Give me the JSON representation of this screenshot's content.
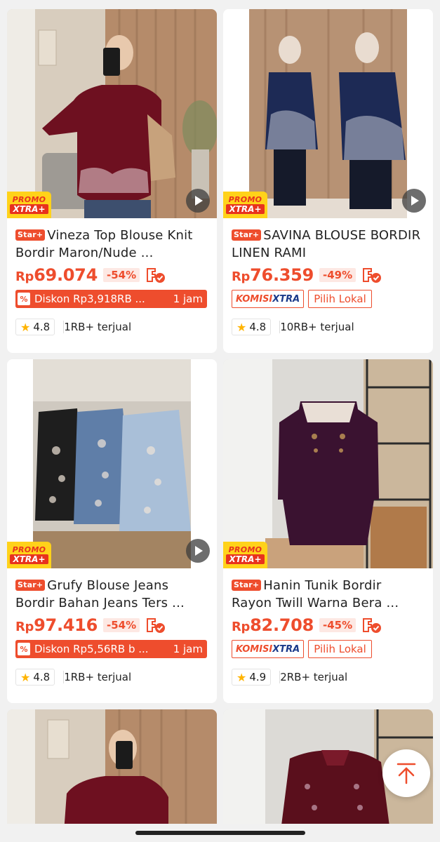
{
  "products": [
    {
      "promo_line1": "PROMO",
      "promo_line2": "XTRA+",
      "star_label": "Star+",
      "title": "Vineza Top Blouse Knit Bordir Maron/Nude ...",
      "price_currency": "Rp",
      "price_amount": "69.074",
      "discount": "-54%",
      "tag_type": "diskon",
      "diskon_text": "Diskon Rp3,918RB ...",
      "diskon_time": "1 jam",
      "rating": "4.8",
      "sold": "1RB+ terjual"
    },
    {
      "promo_line1": "PROMO",
      "promo_line2": "XTRA+",
      "star_label": "Star+",
      "title": "SAVINA BLOUSE BORDIR LINEN RAMI",
      "price_currency": "Rp",
      "price_amount": "76.359",
      "discount": "-49%",
      "tag_type": "komisi",
      "komisi_part1": "KOMISI",
      "komisi_part2": "XTRA",
      "lokal_label": "Pilih Lokal",
      "rating": "4.8",
      "sold": "10RB+ terjual"
    },
    {
      "promo_line1": "PROMO",
      "promo_line2": "XTRA+",
      "star_label": "Star+",
      "title": "Grufy Blouse Jeans Bordir Bahan Jeans Ters ...",
      "price_currency": "Rp",
      "price_amount": "97.416",
      "discount": "-54%",
      "tag_type": "diskon",
      "diskon_text": "Diskon Rp5,56RB b ...",
      "diskon_time": "1 jam",
      "rating": "4.8",
      "sold": "1RB+ terjual"
    },
    {
      "promo_line1": "PROMO",
      "promo_line2": "XTRA+",
      "star_label": "Star+",
      "title": "Hanin Tunik Bordir Rayon Twill Warna Bera ...",
      "price_currency": "Rp",
      "price_amount": "82.708",
      "discount": "-45%",
      "tag_type": "komisi",
      "komisi_part1": "KOMISI",
      "komisi_part2": "XTRA",
      "lokal_label": "Pilih Lokal",
      "rating": "4.9",
      "sold": "2RB+ terjual"
    }
  ],
  "icons": {
    "play": "play-icon",
    "star": "star-icon",
    "cod": "cod-check-icon",
    "percent": "percent-icon",
    "scroll_top": "arrow-up-to-top-icon"
  },
  "colors": {
    "accent": "#ee4d2d",
    "promo_yellow": "#ffd21a",
    "komisi_blue": "#1a3a8a",
    "rating_star": "#ffb400"
  }
}
